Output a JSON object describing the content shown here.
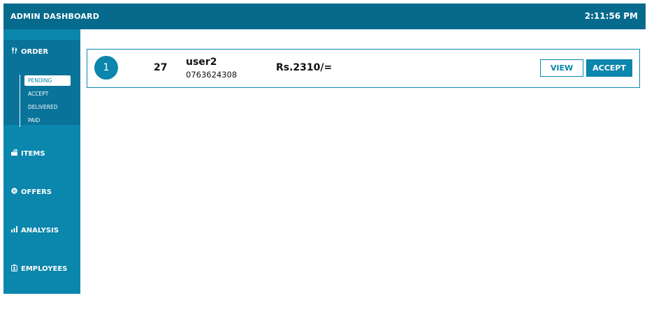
{
  "header": {
    "title": "ADMIN DASHBOARD",
    "clock": "2:11:56 PM"
  },
  "sidebar": {
    "order": {
      "label": "ORDER",
      "icon": "utensils-icon",
      "submenu": [
        "PENDING",
        "ACCEPT",
        "DELIVERED",
        "PAID"
      ],
      "active": "PENDING"
    },
    "items": [
      {
        "label": "ITEMS",
        "icon": "stack-icon"
      },
      {
        "label": "OFFERS",
        "icon": "badge-percent-icon"
      },
      {
        "label": "ANALYSIS",
        "icon": "bar-chart-icon"
      },
      {
        "label": "EMPLOYEES",
        "icon": "id-badge-icon"
      }
    ]
  },
  "orders": [
    {
      "index": "1",
      "order_no": "27",
      "customer": "user2",
      "phone": "0763624308",
      "amount": "Rs.2310/=",
      "view_label": "VIEW",
      "accept_label": "ACCEPT"
    }
  ],
  "colors": {
    "topbar": "#066a8c",
    "sidebar": "#0b86ac",
    "sidebar_active_block": "#09739a",
    "accent": "#0b86ac"
  }
}
